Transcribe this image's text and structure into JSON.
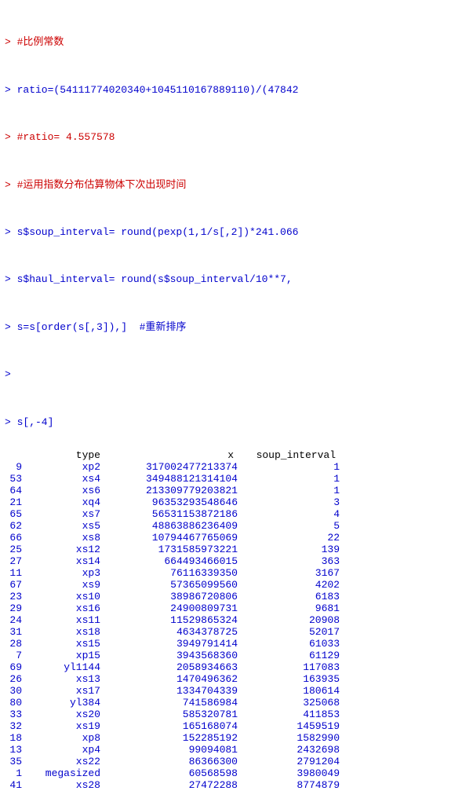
{
  "console": {
    "lines": [
      {
        "type": "comment",
        "text": "> #比例常数"
      },
      {
        "type": "code",
        "text": "> ratio=(54111774020340+1045110167889110)/(47842"
      },
      {
        "type": "comment",
        "text": "> #ratio= 4.557578"
      },
      {
        "type": "comment",
        "text": "> #运用指数分布估算物体下次出现时间"
      },
      {
        "type": "code",
        "text": "> s$soup_interval= round(pexp(1,1/s[,2])*241.066"
      },
      {
        "type": "code",
        "text": "> s$haul_interval= round(s$soup_interval/10**7,"
      },
      {
        "type": "code",
        "text": "> s=s[order(s[,3]),]  #重新排序"
      },
      {
        "type": "blank",
        "text": ">"
      },
      {
        "type": "code",
        "text": "> s[,-4]"
      }
    ],
    "table_headers": [
      "",
      "type",
      "x",
      "soup_interval"
    ],
    "rows": [
      {
        "rn": "9",
        "type": "xp2",
        "x": "317002477213374",
        "si": "1"
      },
      {
        "rn": "53",
        "type": "xs4",
        "x": "349488121314104",
        "si": "1"
      },
      {
        "rn": "64",
        "type": "xs6",
        "x": "213309779203821",
        "si": "1"
      },
      {
        "rn": "21",
        "type": "xq4",
        "x": "96353293548646",
        "si": "3"
      },
      {
        "rn": "65",
        "type": "xs7",
        "x": "56531153872186",
        "si": "4"
      },
      {
        "rn": "62",
        "type": "xs5",
        "x": "48863886236409",
        "si": "5"
      },
      {
        "rn": "66",
        "type": "xs8",
        "x": "10794467765069",
        "si": "22"
      },
      {
        "rn": "25",
        "type": "xs12",
        "x": "1731585973221",
        "si": "139"
      },
      {
        "rn": "27",
        "type": "xs14",
        "x": "664493466015",
        "si": "363"
      },
      {
        "rn": "11",
        "type": "xp3",
        "x": "76116339350",
        "si": "3167"
      },
      {
        "rn": "67",
        "type": "xs9",
        "x": "57365099560",
        "si": "4202"
      },
      {
        "rn": "23",
        "type": "xs10",
        "x": "38986720806",
        "si": "6183"
      },
      {
        "rn": "29",
        "type": "xs16",
        "x": "24900809731",
        "si": "9681"
      },
      {
        "rn": "24",
        "type": "xs11",
        "x": "11529865324",
        "si": "20908"
      },
      {
        "rn": "31",
        "type": "xs18",
        "x": "4634378725",
        "si": "52017"
      },
      {
        "rn": "28",
        "type": "xs15",
        "x": "3949791414",
        "si": "61033"
      },
      {
        "rn": "7",
        "type": "xp15",
        "x": "3943568360",
        "si": "61129"
      },
      {
        "rn": "69",
        "type": "yl1144",
        "x": "2058934663",
        "si": "117083"
      },
      {
        "rn": "26",
        "type": "xs13",
        "x": "1470496362",
        "si": "163935"
      },
      {
        "rn": "30",
        "type": "xs17",
        "x": "1334704339",
        "si": "180614"
      },
      {
        "rn": "80",
        "type": "yl384",
        "x": "741586984",
        "si": "325068"
      },
      {
        "rn": "33",
        "type": "xs20",
        "x": "585320781",
        "si": "411853"
      },
      {
        "rn": "32",
        "type": "xs19",
        "x": "165168074",
        "si": "1459519"
      },
      {
        "rn": "18",
        "type": "xp8",
        "x": "152285192",
        "si": "1582990"
      },
      {
        "rn": "13",
        "type": "xp4",
        "x": "99094081",
        "si": "2432698"
      },
      {
        "rn": "35",
        "type": "xs22",
        "x": "86366300",
        "si": "2791204"
      },
      {
        "rn": "1",
        "type": "megasized",
        "x": "60568598",
        "si": "3980049"
      },
      {
        "rn": "41",
        "type": "xs28",
        "x": "27472288",
        "si": "8774879"
      }
    ]
  }
}
